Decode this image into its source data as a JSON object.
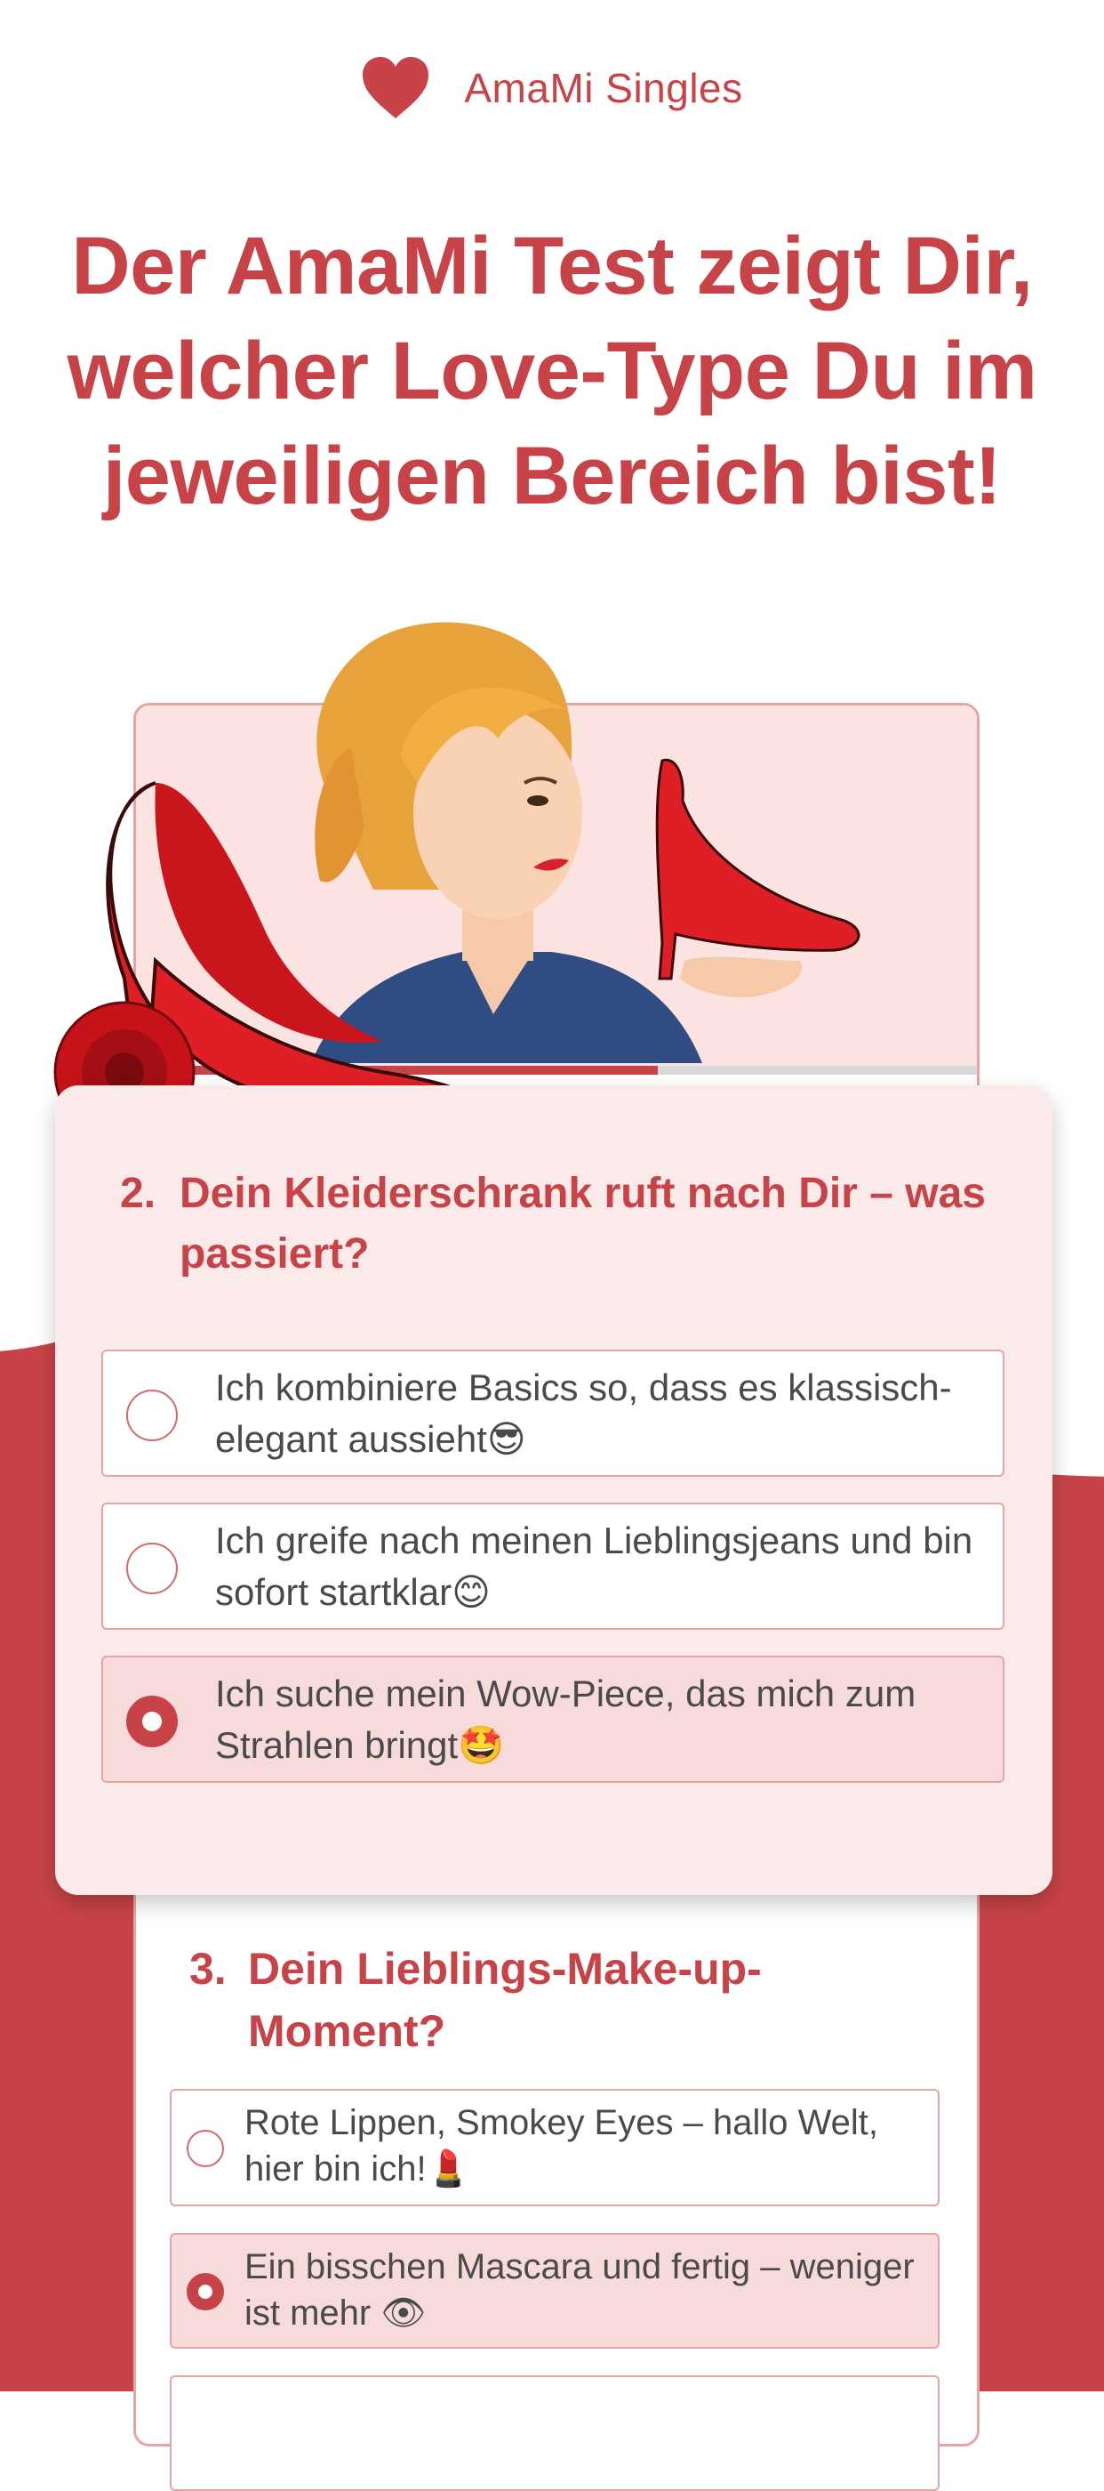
{
  "header": {
    "brand": "AmaMi Singles",
    "logo_icon": "heart-icon"
  },
  "headline": "Der AmaMi Test zeigt Dir, welcher Love-Type Du im jeweiligen Bereich bist!",
  "colors": {
    "accent": "#c84347",
    "card_bg": "#fbeaea",
    "illustration_bg": "#fbe3e1",
    "border": "#e7a4a6"
  },
  "quiz": {
    "progress": 0.62,
    "questions": [
      {
        "number": "2.",
        "text": "Dein Kleiderschrank ruft nach Dir – was passiert?",
        "options": [
          {
            "text": "Ich kombiniere Basics so, dass es klassisch-elegant aussieht",
            "emoji": "😎",
            "selected": false
          },
          {
            "text": "Ich greife nach meinen Lieblingsjeans und bin sofort startklar",
            "emoji": "😊",
            "selected": false
          },
          {
            "text": "Ich suche mein Wow-Piece, das mich zum Strahlen bringt",
            "emoji": "🤩",
            "selected": true
          }
        ]
      },
      {
        "number": "3.",
        "text": "Dein Lieblings-Make-up-Moment?",
        "options": [
          {
            "text": "Rote Lippen, Smokey Eyes – hallo Welt, hier bin ich!",
            "emoji": "💄",
            "selected": false
          },
          {
            "text": "Ein bisschen Mascara und fertig – weniger ist mehr",
            "emoji": "👁",
            "selected": true
          }
        ]
      }
    ]
  }
}
